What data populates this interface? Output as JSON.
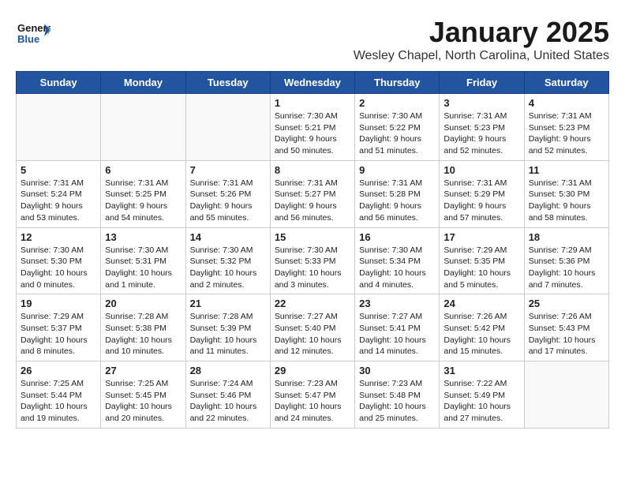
{
  "header": {
    "logo_general": "General",
    "logo_blue": "Blue",
    "month": "January 2025",
    "location": "Wesley Chapel, North Carolina, United States"
  },
  "weekdays": [
    "Sunday",
    "Monday",
    "Tuesday",
    "Wednesday",
    "Thursday",
    "Friday",
    "Saturday"
  ],
  "weeks": [
    [
      {
        "day": "",
        "content": ""
      },
      {
        "day": "",
        "content": ""
      },
      {
        "day": "",
        "content": ""
      },
      {
        "day": "1",
        "content": "Sunrise: 7:30 AM\nSunset: 5:21 PM\nDaylight: 9 hours\nand 50 minutes."
      },
      {
        "day": "2",
        "content": "Sunrise: 7:30 AM\nSunset: 5:22 PM\nDaylight: 9 hours\nand 51 minutes."
      },
      {
        "day": "3",
        "content": "Sunrise: 7:31 AM\nSunset: 5:23 PM\nDaylight: 9 hours\nand 52 minutes."
      },
      {
        "day": "4",
        "content": "Sunrise: 7:31 AM\nSunset: 5:23 PM\nDaylight: 9 hours\nand 52 minutes."
      }
    ],
    [
      {
        "day": "5",
        "content": "Sunrise: 7:31 AM\nSunset: 5:24 PM\nDaylight: 9 hours\nand 53 minutes."
      },
      {
        "day": "6",
        "content": "Sunrise: 7:31 AM\nSunset: 5:25 PM\nDaylight: 9 hours\nand 54 minutes."
      },
      {
        "day": "7",
        "content": "Sunrise: 7:31 AM\nSunset: 5:26 PM\nDaylight: 9 hours\nand 55 minutes."
      },
      {
        "day": "8",
        "content": "Sunrise: 7:31 AM\nSunset: 5:27 PM\nDaylight: 9 hours\nand 56 minutes."
      },
      {
        "day": "9",
        "content": "Sunrise: 7:31 AM\nSunset: 5:28 PM\nDaylight: 9 hours\nand 56 minutes."
      },
      {
        "day": "10",
        "content": "Sunrise: 7:31 AM\nSunset: 5:29 PM\nDaylight: 9 hours\nand 57 minutes."
      },
      {
        "day": "11",
        "content": "Sunrise: 7:31 AM\nSunset: 5:30 PM\nDaylight: 9 hours\nand 58 minutes."
      }
    ],
    [
      {
        "day": "12",
        "content": "Sunrise: 7:30 AM\nSunset: 5:30 PM\nDaylight: 10 hours\nand 0 minutes."
      },
      {
        "day": "13",
        "content": "Sunrise: 7:30 AM\nSunset: 5:31 PM\nDaylight: 10 hours\nand 1 minute."
      },
      {
        "day": "14",
        "content": "Sunrise: 7:30 AM\nSunset: 5:32 PM\nDaylight: 10 hours\nand 2 minutes."
      },
      {
        "day": "15",
        "content": "Sunrise: 7:30 AM\nSunset: 5:33 PM\nDaylight: 10 hours\nand 3 minutes."
      },
      {
        "day": "16",
        "content": "Sunrise: 7:30 AM\nSunset: 5:34 PM\nDaylight: 10 hours\nand 4 minutes."
      },
      {
        "day": "17",
        "content": "Sunrise: 7:29 AM\nSunset: 5:35 PM\nDaylight: 10 hours\nand 5 minutes."
      },
      {
        "day": "18",
        "content": "Sunrise: 7:29 AM\nSunset: 5:36 PM\nDaylight: 10 hours\nand 7 minutes."
      }
    ],
    [
      {
        "day": "19",
        "content": "Sunrise: 7:29 AM\nSunset: 5:37 PM\nDaylight: 10 hours\nand 8 minutes."
      },
      {
        "day": "20",
        "content": "Sunrise: 7:28 AM\nSunset: 5:38 PM\nDaylight: 10 hours\nand 10 minutes."
      },
      {
        "day": "21",
        "content": "Sunrise: 7:28 AM\nSunset: 5:39 PM\nDaylight: 10 hours\nand 11 minutes."
      },
      {
        "day": "22",
        "content": "Sunrise: 7:27 AM\nSunset: 5:40 PM\nDaylight: 10 hours\nand 12 minutes."
      },
      {
        "day": "23",
        "content": "Sunrise: 7:27 AM\nSunset: 5:41 PM\nDaylight: 10 hours\nand 14 minutes."
      },
      {
        "day": "24",
        "content": "Sunrise: 7:26 AM\nSunset: 5:42 PM\nDaylight: 10 hours\nand 15 minutes."
      },
      {
        "day": "25",
        "content": "Sunrise: 7:26 AM\nSunset: 5:43 PM\nDaylight: 10 hours\nand 17 minutes."
      }
    ],
    [
      {
        "day": "26",
        "content": "Sunrise: 7:25 AM\nSunset: 5:44 PM\nDaylight: 10 hours\nand 19 minutes."
      },
      {
        "day": "27",
        "content": "Sunrise: 7:25 AM\nSunset: 5:45 PM\nDaylight: 10 hours\nand 20 minutes."
      },
      {
        "day": "28",
        "content": "Sunrise: 7:24 AM\nSunset: 5:46 PM\nDaylight: 10 hours\nand 22 minutes."
      },
      {
        "day": "29",
        "content": "Sunrise: 7:23 AM\nSunset: 5:47 PM\nDaylight: 10 hours\nand 24 minutes."
      },
      {
        "day": "30",
        "content": "Sunrise: 7:23 AM\nSunset: 5:48 PM\nDaylight: 10 hours\nand 25 minutes."
      },
      {
        "day": "31",
        "content": "Sunrise: 7:22 AM\nSunset: 5:49 PM\nDaylight: 10 hours\nand 27 minutes."
      },
      {
        "day": "",
        "content": ""
      }
    ]
  ]
}
